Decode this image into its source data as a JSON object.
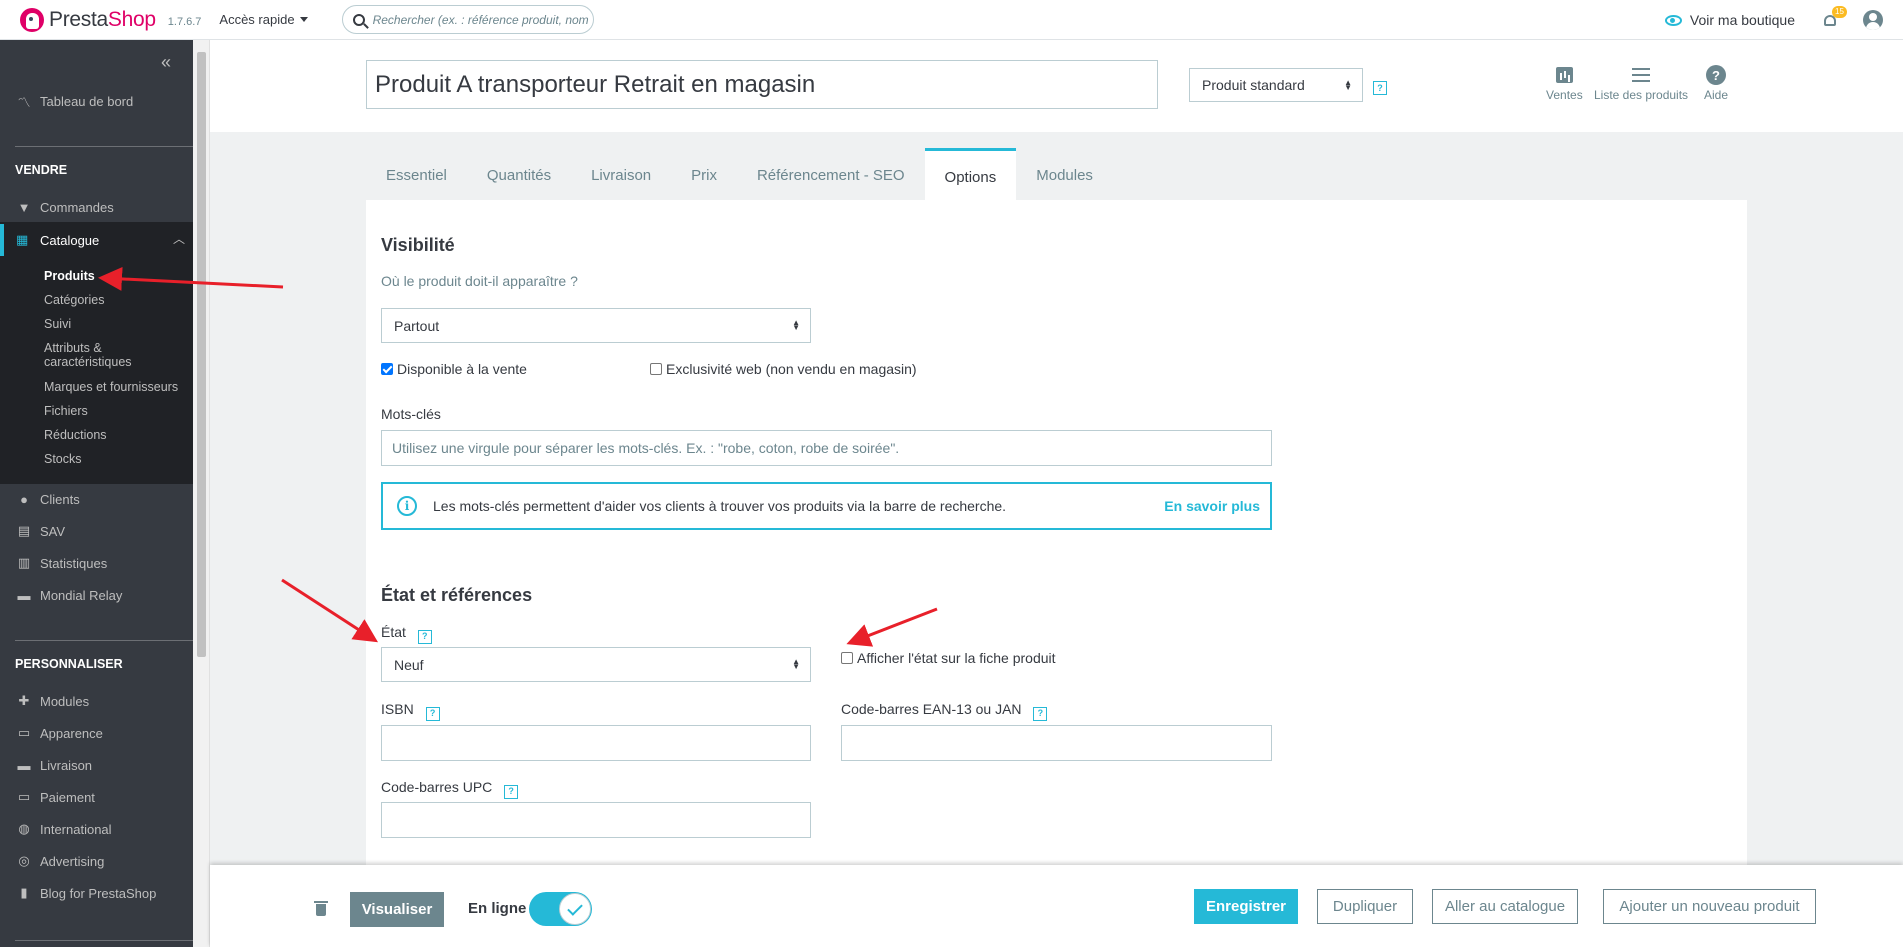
{
  "header": {
    "logo_part1": "Presta",
    "logo_part2": "Shop",
    "version": "1.7.6.7",
    "quick_access": "Accès rapide",
    "search_placeholder": "Rechercher (ex. : référence produit, nom",
    "view_shop": "Voir ma boutique",
    "notifications_count": "15"
  },
  "sidebar": {
    "collapse": "«",
    "dashboard": "Tableau de bord",
    "sell_title": "VENDRE",
    "orders": "Commandes",
    "catalog": "Catalogue",
    "catalog_items": [
      "Produits",
      "Catégories",
      "Suivi",
      "Attributs &",
      "caractéristiques",
      "Marques et fournisseurs",
      "Fichiers",
      "Réductions",
      "Stocks"
    ],
    "customers": "Clients",
    "sav": "SAV",
    "stats": "Statistiques",
    "mondial": "Mondial Relay",
    "customize_title": "PERSONNALISER",
    "modules": "Modules",
    "appearance": "Apparence",
    "shipping": "Livraison",
    "payment": "Paiement",
    "international": "International",
    "advertising": "Advertising",
    "blog": "Blog for PrestaShop"
  },
  "product": {
    "name": "Produit A transporteur Retrait en magasin",
    "type": "Produit standard",
    "toolbar": {
      "sales": "Ventes",
      "list": "Liste des produits",
      "help": "Aide"
    }
  },
  "tabs": [
    "Essentiel",
    "Quantités",
    "Livraison",
    "Prix",
    "Référencement - SEO",
    "Options",
    "Modules"
  ],
  "options": {
    "visibility_title": "Visibilité",
    "visibility_question": "Où le produit doit-il apparaître ?",
    "visibility_value": "Partout",
    "available_for_sale": "Disponible à la vente",
    "web_exclusive": "Exclusivité web (non vendu en magasin)",
    "keywords_label": "Mots-clés",
    "keywords_placeholder": "Utilisez une virgule pour séparer les mots-clés. Ex. : \"robe, coton, robe de soirée\".",
    "keywords_info": "Les mots-clés permettent d'aider vos clients à trouver vos produits via la barre de recherche.",
    "learn_more": "En savoir plus",
    "state_title": "État et références",
    "condition_label": "État",
    "condition_value": "Neuf",
    "show_condition": "Afficher l'état sur la fiche produit",
    "isbn_label": "ISBN",
    "ean_label": "Code-barres EAN-13 ou JAN",
    "upc_label": "Code-barres UPC"
  },
  "footer": {
    "preview": "Visualiser",
    "online": "En ligne",
    "save": "Enregistrer",
    "duplicate": "Dupliquer",
    "go_catalog": "Aller au catalogue",
    "add_new": "Ajouter un nouveau produit"
  },
  "colors": {
    "accent": "#25b9d7",
    "sidebar": "#363a41",
    "brand": "#df0067",
    "annotation": "#e8202a"
  }
}
